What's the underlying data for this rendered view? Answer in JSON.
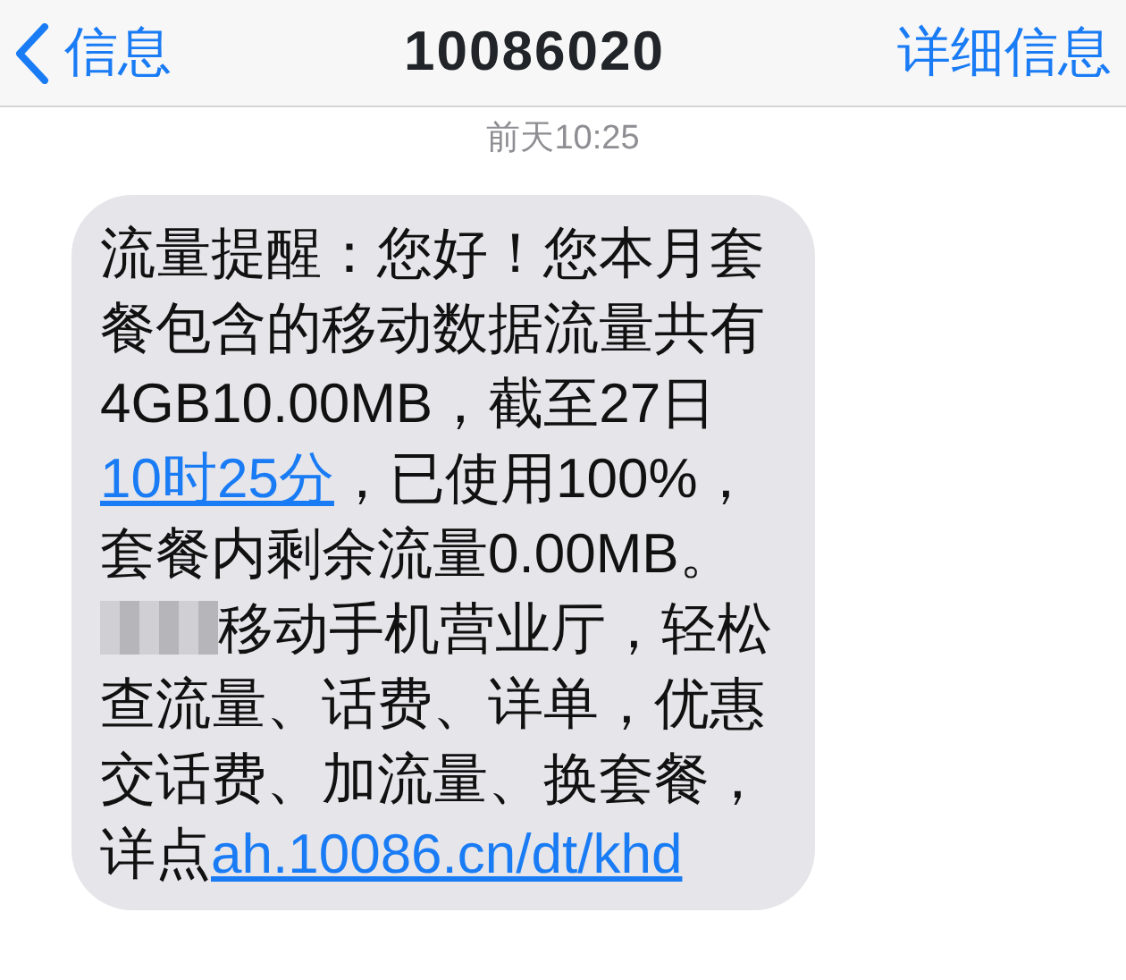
{
  "nav": {
    "back_label": "信息",
    "title": "10086020",
    "action": "详细信息"
  },
  "timestamp": "前天10:25",
  "message": [
    {
      "kind": "text",
      "text": "流量提醒：您好！您本月套餐包含的移动数据流量共有4GB10.00MB，截至27日"
    },
    {
      "kind": "link",
      "text": "10时25分"
    },
    {
      "kind": "text",
      "text": "，已使用100%，套餐内剩余流量0.00MB。"
    },
    {
      "kind": "redacted"
    },
    {
      "kind": "text",
      "text": "移动手机营业厅，轻松查流量、话费、详单，优惠交话费、加流量、换套餐，详点"
    },
    {
      "kind": "link",
      "text": "ah.10086.cn/dt/khd"
    }
  ]
}
